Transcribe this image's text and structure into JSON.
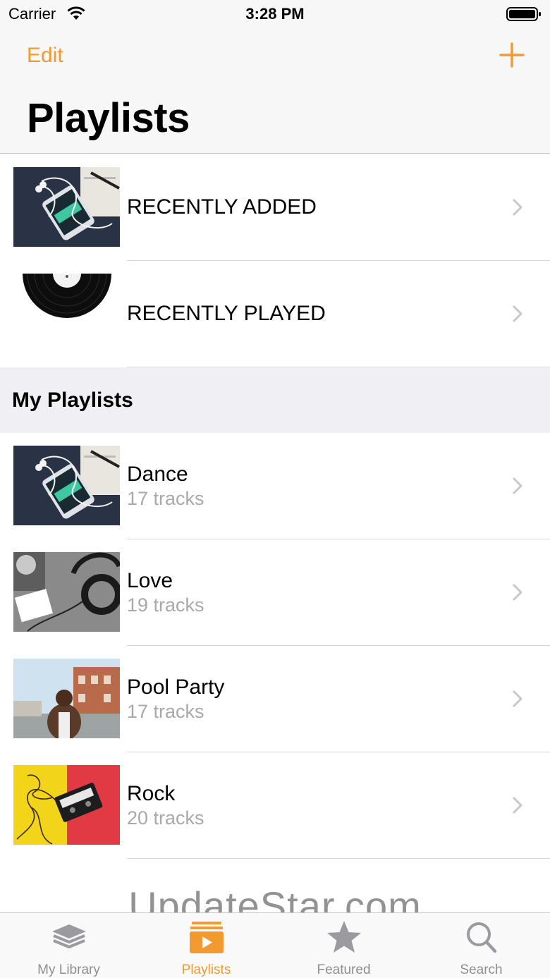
{
  "status_bar": {
    "carrier": "Carrier",
    "time": "3:28 PM"
  },
  "nav": {
    "edit_label": "Edit",
    "add_icon": "plus-icon",
    "title": "Playlists"
  },
  "smart_playlists": [
    {
      "title": "RECENTLY ADDED"
    },
    {
      "title": "RECENTLY PLAYED"
    }
  ],
  "section": {
    "title": "My Playlists"
  },
  "playlists": [
    {
      "name": "Dance",
      "tracks": "17 tracks"
    },
    {
      "name": "Love",
      "tracks": "19 tracks"
    },
    {
      "name": "Pool Party",
      "tracks": "17 tracks"
    },
    {
      "name": "Rock",
      "tracks": "20 tracks"
    }
  ],
  "watermark": "UpdateStar.com",
  "tabs": [
    {
      "label": "My Library",
      "icon": "library-stack-icon",
      "active": false
    },
    {
      "label": "Playlists",
      "icon": "playlists-icon",
      "active": true
    },
    {
      "label": "Featured",
      "icon": "star-icon",
      "active": false
    },
    {
      "label": "Search",
      "icon": "search-icon",
      "active": false
    }
  ],
  "colors": {
    "accent": "#f19a2f",
    "inactive": "#8e8e93",
    "section_bg": "#efeff4"
  }
}
